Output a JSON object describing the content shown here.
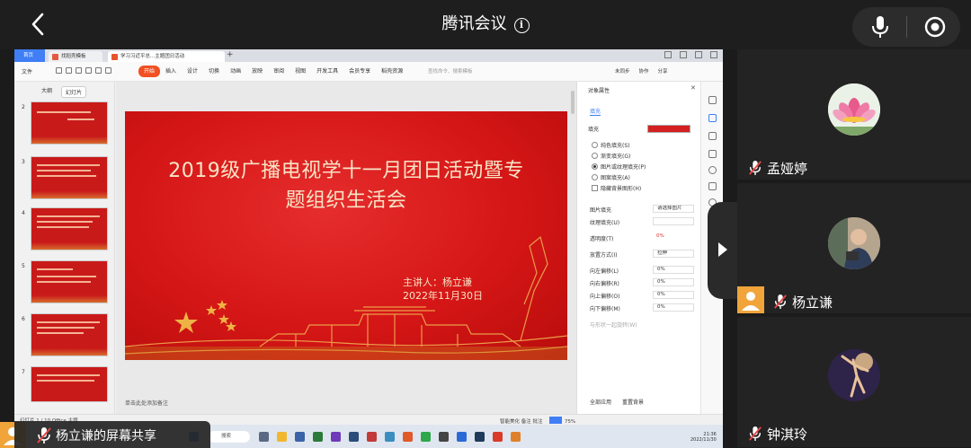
{
  "meeting": {
    "title": "腾讯会议",
    "info_icon": "i"
  },
  "app": {
    "tabs": [
      "首页",
      "找稻壳模板",
      "学习习近平总...主题团日活动"
    ],
    "menu_file": "文件",
    "menu_items": [
      "开始",
      "插入",
      "设计",
      "切换",
      "动画",
      "放映",
      "审阅",
      "视图",
      "开发工具",
      "会员专享",
      "稻壳资源"
    ],
    "search_placeholder": "查找命令、搜索模板",
    "menu_right": [
      "未同步",
      "协作",
      "分享"
    ]
  },
  "left_panel": {
    "tabs": [
      "大纲",
      "幻灯片"
    ],
    "thumb_numbers": [
      "2",
      "3",
      "4",
      "5",
      "6",
      "7"
    ],
    "add": "+"
  },
  "slide": {
    "title": "2019级广播电视学十一月团日活动暨专\n题组织生活会",
    "speaker": "主讲人：杨立谦",
    "date": "2022年11月30日",
    "notes_placeholder": "单击此处添加备注"
  },
  "right_panel": {
    "title": "对象属性",
    "fill_tab": "填充",
    "section": "填充",
    "options": [
      "纯色填充(S)",
      "渐变填充(G)",
      "图片或纹理填充(P)",
      "图案填充(A)",
      "隐藏背景图形(H)"
    ],
    "selected_option": "图片或纹理填充(P)",
    "rows": [
      {
        "label": "图片填充",
        "value": "请选择图片"
      },
      {
        "label": "纹理填充(U)",
        "value": ""
      },
      {
        "label": "透明度(T)",
        "value": "0%"
      },
      {
        "label": "放置方式(I)",
        "value": "拉伸"
      },
      {
        "label": "向左偏移(L)",
        "value": "0%"
      },
      {
        "label": "向右偏移(R)",
        "value": "0%"
      },
      {
        "label": "向上偏移(O)",
        "value": "0%"
      },
      {
        "label": "向下偏移(M)",
        "value": "0%"
      }
    ],
    "rotate_with_shape": "与形状一起旋转(W)",
    "bottom_buttons": [
      "全部应用",
      "重置背景"
    ]
  },
  "statusbar": {
    "left": "幻灯片 1 / 10    Office 主题",
    "right": "智能美化   备注   批注",
    "zoom": "75%"
  },
  "taskbar": {
    "search": "搜索",
    "time": "21:36",
    "date": "2022/11/30"
  },
  "share_banner": {
    "text": "杨立谦的屏幕共享"
  },
  "participants": [
    {
      "name": "孟娅婷",
      "avatar": "lotus-avatar",
      "muted": true
    },
    {
      "name": "杨立谦",
      "avatar": "photo-avatar",
      "muted": true,
      "sharing": true
    },
    {
      "name": "钟淇玲",
      "avatar": "dancer-avatar",
      "muted": true
    }
  ],
  "colors": {
    "slide_red": "#d51616",
    "slide_gold": "#f7e4c6",
    "accent_orange": "#f0a43a",
    "wps_blue": "#3f7ef5",
    "menu_active": "#f25022"
  }
}
